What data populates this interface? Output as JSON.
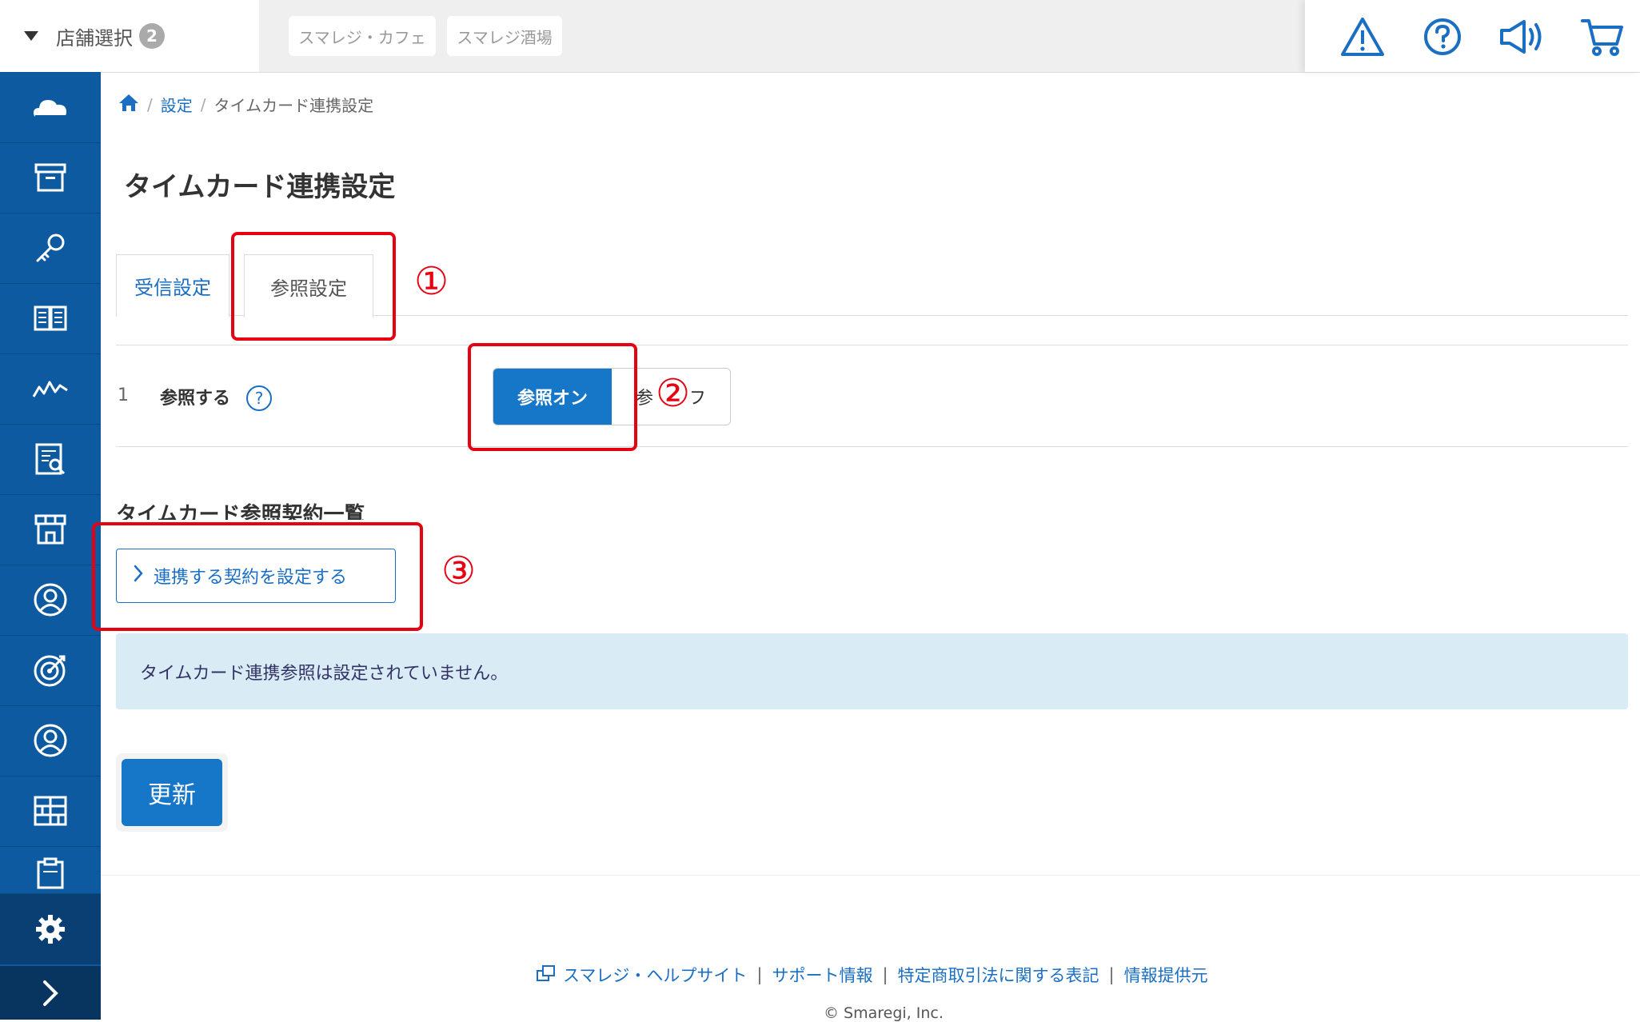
{
  "topbar": {
    "store_select_label": "店舗選択",
    "store_count": "2",
    "store_chips": [
      "スマレジ・カフェ",
      "スマレジ酒場"
    ],
    "icons": [
      "warning-icon",
      "help-icon",
      "megaphone-icon",
      "cart-icon"
    ]
  },
  "sidebar": {
    "icons": [
      "cloud-icon",
      "archive-icon",
      "key-icon",
      "book-icon",
      "chart-icon",
      "report-icon",
      "store-icon",
      "user-icon",
      "target-icon",
      "customer-icon",
      "grid-icon",
      "clipboard-icon"
    ],
    "settings_icon": "gear-icon",
    "expand_icon": "chevron-right-icon"
  },
  "breadcrumb": {
    "home_icon": "home-icon",
    "items": [
      "設定",
      "タイムカード連携設定"
    ],
    "separator": "/"
  },
  "page": {
    "title": "タイムカード連携設定"
  },
  "tabs": [
    {
      "label": "受信設定",
      "active": false
    },
    {
      "label": "参照設定",
      "active": true
    }
  ],
  "setting_row": {
    "number": "1",
    "label": "参照する",
    "help": "?",
    "toggle_on": "参照オン",
    "toggle_off": "参照オフ",
    "selected": "参照オン"
  },
  "contracts": {
    "heading": "タイムカード参照契約一覧",
    "link_button": "連携する契約を設定する",
    "empty_message": "タイムカード連携参照は設定されていません。"
  },
  "actions": {
    "update": "更新"
  },
  "footer": {
    "links": [
      "スマレジ・ヘルプサイト",
      "サポート情報",
      "特定商取引法に関する表記",
      "情報提供元"
    ],
    "separator": "|",
    "copyright": "© Smaregi, Inc."
  },
  "annotations": {
    "marks": [
      "①",
      "②",
      "③"
    ],
    "color": "#e60012"
  }
}
